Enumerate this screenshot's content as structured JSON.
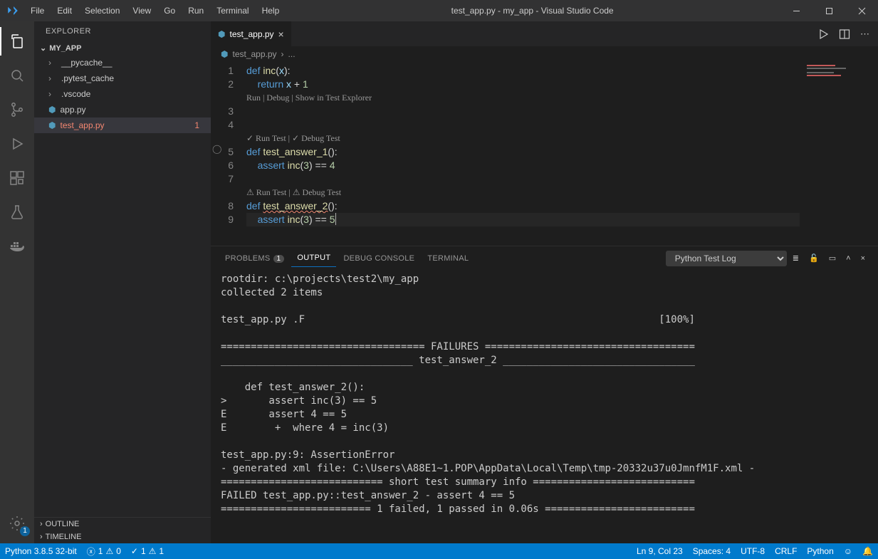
{
  "menubar": {
    "items": [
      "File",
      "Edit",
      "Selection",
      "View",
      "Go",
      "Run",
      "Terminal",
      "Help"
    ]
  },
  "title": "test_app.py - my_app - Visual Studio Code",
  "sidebar": {
    "title": "EXPLORER",
    "root": "MY_APP",
    "items": [
      {
        "name": "__pycache__",
        "type": "folder"
      },
      {
        "name": ".pytest_cache",
        "type": "folder"
      },
      {
        "name": ".vscode",
        "type": "folder"
      },
      {
        "name": "app.py",
        "type": "py"
      },
      {
        "name": "test_app.py",
        "type": "py",
        "selected": true,
        "error": true,
        "errcount": "1"
      }
    ],
    "outline": "OUTLINE",
    "timeline": "TIMELINE"
  },
  "tabs": [
    {
      "label": "test_app.py",
      "active": true
    }
  ],
  "breadcrumb": {
    "file": "test_app.py",
    "sep": "›",
    "more": "..."
  },
  "codelens": {
    "inc": "Run | Debug | Show in Test Explorer",
    "t1": "Run Test | ✓ Debug Test",
    "t1prefix": "✓",
    "t2": "Run Test | ⚠ Debug Test",
    "t2prefix": "⚠"
  },
  "code": {
    "lines": [
      {
        "n": "1",
        "html": "<span class='kw'>def</span> <span class='fn'>inc</span>(<span class='param'>x</span>):"
      },
      {
        "n": "2",
        "html": "    <span class='kw'>return</span> <span class='param'>x</span> + <span class='num'>1</span>"
      },
      {
        "n": "",
        "lens": "inc"
      },
      {
        "n": "3",
        "html": ""
      },
      {
        "n": "4",
        "html": ""
      },
      {
        "n": "",
        "lens": "t1",
        "lensprefix": "✓ "
      },
      {
        "n": "5",
        "html": "<span class='kw'>def</span> <span class='fn'>test_answer_1</span>():",
        "bp": true
      },
      {
        "n": "6",
        "html": "    <span class='kw'>assert</span> <span class='fn'>inc</span>(<span class='num'>3</span>) == <span class='num'>4</span>"
      },
      {
        "n": "7",
        "html": ""
      },
      {
        "n": "",
        "lens": "t2",
        "lensprefix": "⚠ "
      },
      {
        "n": "8",
        "html": "<span class='kw'>def</span> <span class='fn err-underline'>test_answer_2</span>():"
      },
      {
        "n": "9",
        "html": "    <span class='kw'>assert</span> <span class='fn'>inc</span>(<span class='num'>3</span>) == <span class='num'>5</span><span class='cursor-caret'></span>",
        "current": true
      }
    ]
  },
  "panel": {
    "tabs": {
      "problems": "PROBLEMS",
      "problemsBadge": "1",
      "output": "OUTPUT",
      "debug": "DEBUG CONSOLE",
      "terminal": "TERMINAL"
    },
    "logSelector": "Python Test Log",
    "output": "rootdir: c:\\projects\\test2\\my_app\ncollected 2 items\n\ntest_app.py .F                                                           [100%]\n\n================================== FAILURES ===================================\n________________________________ test_answer_2 ________________________________\n\n    def test_answer_2():\n>       assert inc(3) == 5\nE       assert 4 == 5\nE        +  where 4 = inc(3)\n\ntest_app.py:9: AssertionError\n- generated xml file: C:\\Users\\A88E1~1.POP\\AppData\\Local\\Temp\\tmp-20332u37u0JmnfM1F.xml -\n=========================== short test summary info ===========================\nFAILED test_app.py::test_answer_2 - assert 4 == 5\n========================= 1 failed, 1 passed in 0.06s ========================="
  },
  "status": {
    "python": "Python 3.8.5 32-bit",
    "errors": "1",
    "warnings": "0",
    "pass": "1",
    "fail": "1",
    "cursor": "Ln 9, Col 23",
    "spaces": "Spaces: 4",
    "encoding": "UTF-8",
    "eol": "CRLF",
    "lang": "Python"
  },
  "activity": {
    "settingsBadge": "1"
  }
}
